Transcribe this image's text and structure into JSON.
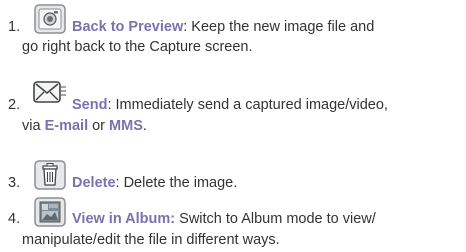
{
  "items": [
    {
      "number": "1.",
      "icon": "camera-preview-icon",
      "term": "Back to Preview",
      "text_after_term": ": Keep the new image file and",
      "continuation": "go right back to the Capture screen."
    },
    {
      "number": "2.",
      "icon": "envelope-send-icon",
      "term": "Send",
      "text_after_term": ": Immediately send a captured image/video,",
      "continuation_prefix": "via ",
      "link1": "E-mail",
      "continuation_mid": " or ",
      "link2": "MMS",
      "continuation_suffix": "."
    },
    {
      "number": "3.",
      "icon": "trash-delete-icon",
      "term": "Delete",
      "text_after_term": ": Delete the image."
    },
    {
      "number": "4.",
      "icon": "album-gallery-icon",
      "term": "View in Album:",
      "text_after_term": " Switch to Album mode to view/",
      "continuation": "manipulate/edit the file in different ways."
    }
  ],
  "colors": {
    "text": "#333333",
    "accent": "#7a72b0",
    "icon_fill": "#e6e8ea",
    "icon_border": "#8a8f95"
  }
}
